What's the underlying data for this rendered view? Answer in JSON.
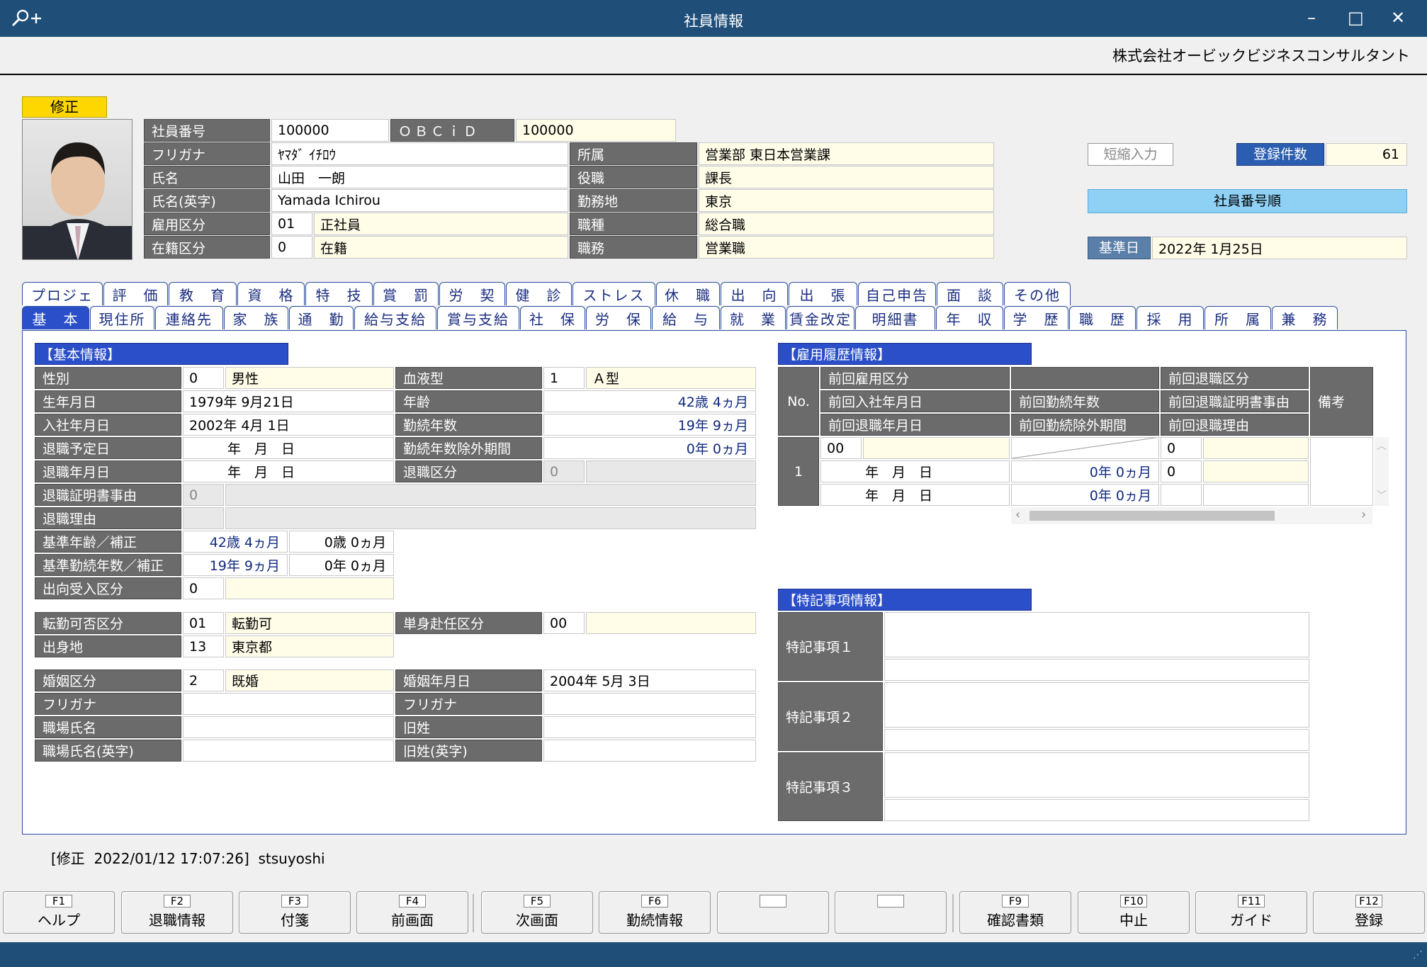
{
  "window": {
    "title": "社員情報",
    "company": "株式会社オービックビジネスコンサルタント",
    "search_icon": "search-plus-icon",
    "minimize": "–",
    "maximize": "□",
    "close": "✕"
  },
  "mode": "修正",
  "header": {
    "emp_no_label": "社員番号",
    "emp_no": "100000",
    "obcid_label": "ＯＢＣｉＤ",
    "obcid": "100000",
    "kana_label": "フリガナ",
    "kana": "ﾔﾏﾀﾞ ｲﾁﾛｳ",
    "name_label": "氏名",
    "name": "山田　一朗",
    "name_en_label": "氏名(英字)",
    "name_en": "Yamada Ichirou",
    "emp_type_label": "雇用区分",
    "emp_type_code": "01",
    "emp_type": "正社員",
    "status_label": "在籍区分",
    "status_code": "0",
    "status": "在籍",
    "dept_label": "所属",
    "dept": "営業部 東日本営業課",
    "post_label": "役職",
    "post": "課長",
    "place_label": "勤務地",
    "place": "東京",
    "job_type_label": "職種",
    "job_type": "総合職",
    "duty_label": "職務",
    "duty": "営業職",
    "short_input": "短縮入力",
    "count_label": "登録件数",
    "count": "61",
    "order": "社員番号順",
    "base_date_label": "基準日",
    "base_date": "2022年  1月25日"
  },
  "tabs_row1": [
    "プロジェ",
    "評　価",
    "教　育",
    "資　格",
    "特　技",
    "賞　罰",
    "労　契",
    "健　診",
    "ストレス",
    "休　職",
    "出　向",
    "出　張",
    "自己申告",
    "面　談",
    "その他"
  ],
  "tabs_row2": [
    "基　本",
    "現住所",
    "連絡先",
    "家　族",
    "通　勤",
    "給与支給",
    "賞与支給",
    "社　保",
    "労　保",
    "給　与",
    "就　業",
    "賃金改定",
    "明細書",
    "年　収",
    "学　歴",
    "職　歴",
    "採　用",
    "所　属",
    "兼　務"
  ],
  "basic": {
    "title": "【基本情報】",
    "sex_label": "性別",
    "sex_code": "0",
    "sex": "男性",
    "blood_label": "血液型",
    "blood_code": "1",
    "blood": "Ａ型",
    "birth_label": "生年月日",
    "birth": "1979年  9月21日",
    "age_label": "年齢",
    "age": "42歳  4ヵ月",
    "join_label": "入社年月日",
    "join": "2002年  4月  1日",
    "years_label": "勤続年数",
    "years": "19年  9ヵ月",
    "plan_retire_label": "退職予定日",
    "plan_retire": "年　月　日",
    "excl_label": "勤続年数除外期間",
    "excl": "0年  0ヵ月",
    "retire_label": "退職年月日",
    "retire": "年　月　日",
    "retire_type_label": "退職区分",
    "retire_type_code": "0",
    "cert_label": "退職証明書事由",
    "cert_code": "0",
    "reason_label": "退職理由",
    "base_age_label": "基準年齢／補正",
    "base_age": "42歳  4ヵ月",
    "base_age_adj": "0歳  0ヵ月",
    "base_years_label": "基準勤続年数／補正",
    "base_years": "19年  9ヵ月",
    "base_years_adj": "0年  0ヵ月",
    "secondment_label": "出向受入区分",
    "secondment_code": "0",
    "transfer_label": "転勤可否区分",
    "transfer_code": "01",
    "transfer": "転勤可",
    "single_label": "単身赴任区分",
    "single_code": "00",
    "origin_label": "出身地",
    "origin_code": "13",
    "origin": "東京都",
    "marriage_label": "婚姻区分",
    "marriage_code": "2",
    "marriage": "既婚",
    "marriage_date_label": "婚姻年月日",
    "marriage_date": "2004年  5月  3日",
    "kana1_label": "フリガナ",
    "kana2_label": "フリガナ",
    "work_name_label": "職場氏名",
    "old_name_label": "旧姓",
    "work_name_en_label": "職場氏名(英字)",
    "old_name_en_label": "旧姓(英字)"
  },
  "history": {
    "title": "【雇用履歴情報】",
    "no_label": "No.",
    "h1": "前回雇用区分",
    "h3": "前回退職区分",
    "h4": "前回入社年月日",
    "h5": "前回勤続年数",
    "h6": "前回退職証明書事由",
    "h7": "前回退職年月日",
    "h8": "前回勤続除外期間",
    "h9": "前回退職理由",
    "note": "備考",
    "row_no": "1",
    "emp_type_code": "00",
    "retire_type_code": "0",
    "join": "年　月　日",
    "years": "0年  0ヵ月",
    "cert_code": "0",
    "retire": "年　月　日",
    "excl": "0年  0ヵ月"
  },
  "notes": {
    "title": "【特記事項情報】",
    "n1": "特記事項１",
    "n2": "特記事項２",
    "n3": "特記事項３"
  },
  "footer": "[修正  2022/01/12 17:07:26]  stsuyoshi",
  "fkeys": [
    {
      "k": "F1",
      "t": "ヘルプ"
    },
    {
      "k": "F2",
      "t": "退職情報"
    },
    {
      "k": "F3",
      "t": "付箋"
    },
    {
      "k": "F4",
      "t": "前画面"
    },
    {
      "k": "F5",
      "t": "次画面"
    },
    {
      "k": "F6",
      "t": "勤続情報"
    },
    {
      "k": "",
      "t": ""
    },
    {
      "k": "",
      "t": ""
    },
    {
      "k": "F9",
      "t": "確認書類"
    },
    {
      "k": "F10",
      "t": "中止"
    },
    {
      "k": "F11",
      "t": "ガイド"
    },
    {
      "k": "F12",
      "t": "登録"
    }
  ]
}
